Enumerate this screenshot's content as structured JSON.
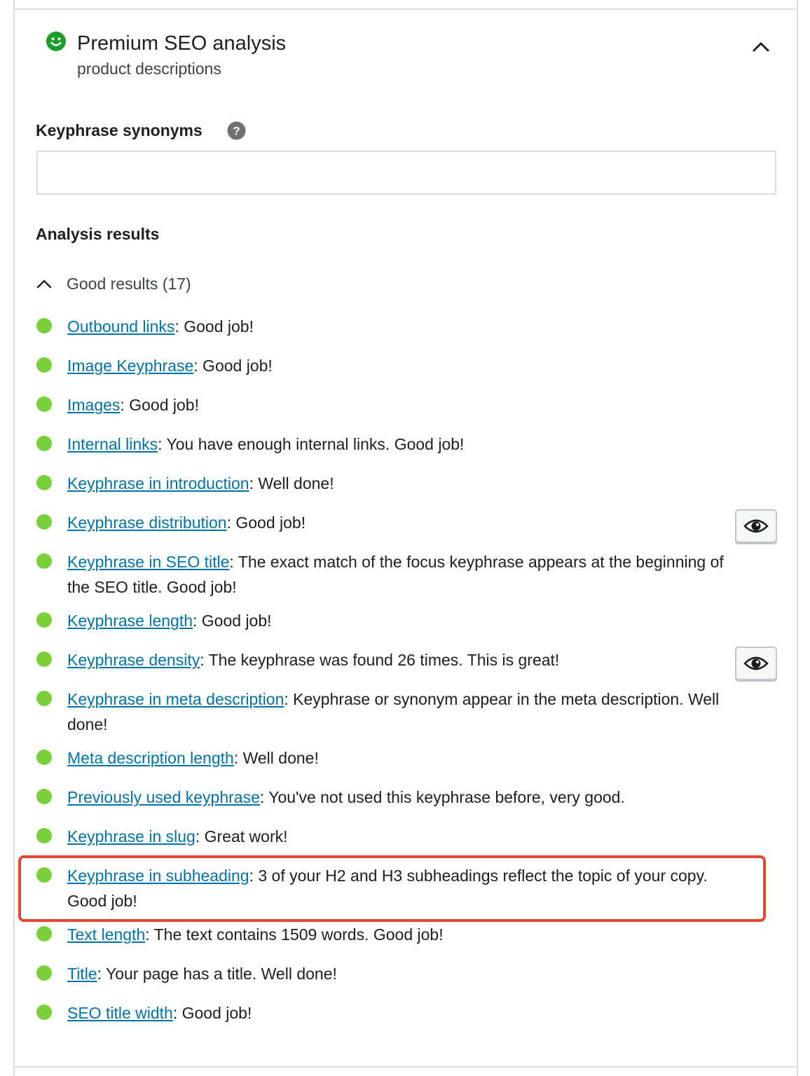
{
  "header": {
    "title": "Premium SEO analysis",
    "subtitle": "product descriptions",
    "status_icon": "smiley-icon",
    "status_color": "#1e9e29",
    "collapse_icon": "chevron-up-icon"
  },
  "synonyms": {
    "label": "Keyphrase synonyms",
    "help_icon": "question-icon",
    "value": "",
    "placeholder": ""
  },
  "analysis": {
    "title": "Analysis results",
    "good_results_label": "Good results (17)",
    "dot_color": "#7ad03a",
    "link_color": "#0073aa",
    "highlight_color": "#e4472f",
    "results": [
      {
        "link": "Outbound links",
        "text": ": Good job!"
      },
      {
        "link": "Image Keyphrase",
        "text": ": Good job!"
      },
      {
        "link": "Images",
        "text": ": Good job!"
      },
      {
        "link": "Internal links",
        "text": ": You have enough internal links. Good job!"
      },
      {
        "link": "Keyphrase in introduction",
        "text": ": Well done!"
      },
      {
        "link": "Keyphrase distribution",
        "text": ": Good job!",
        "has_eye_button": true
      },
      {
        "link": "Keyphrase in SEO title",
        "text": ": The exact match of the focus keyphrase appears at the beginning of the SEO title. Good job!"
      },
      {
        "link": "Keyphrase length",
        "text": ": Good job!"
      },
      {
        "link": "Keyphrase density",
        "text": ": The keyphrase was found 26 times. This is great!",
        "has_eye_button": true
      },
      {
        "link": "Keyphrase in meta description",
        "text": ": Keyphrase or synonym appear in the meta description. Well done!"
      },
      {
        "link": "Meta description length",
        "text": ": Well done!"
      },
      {
        "link": "Previously used keyphrase",
        "text": ": You've not used this keyphrase before, very good."
      },
      {
        "link": "Keyphrase in slug",
        "text": ": Great work!"
      },
      {
        "link": "Keyphrase in subheading",
        "text": ": 3 of your H2 and H3 subheadings reflect the topic of your copy. Good job!",
        "highlighted": true
      },
      {
        "link": "Text length",
        "text": ": The text contains 1509 words. Good job!"
      },
      {
        "link": "Title",
        "text": ": Your page has a title. Well done!"
      },
      {
        "link": "SEO title width",
        "text": ": Good job!"
      }
    ]
  }
}
